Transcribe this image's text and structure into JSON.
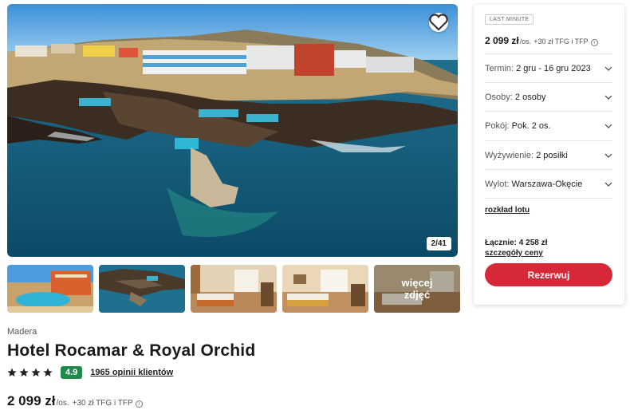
{
  "gallery": {
    "counter": "2/41",
    "more_label": "więcej zdjęć"
  },
  "hotel": {
    "region": "Madera",
    "name": "Hotel Rocamar & Royal Orchid",
    "stars": 4,
    "score": "4.9",
    "reviews": "1965 opinii klientów"
  },
  "price": {
    "amount": "2 099 zł",
    "per": "/os.",
    "extra": "+30 zł TFG i TFP"
  },
  "panel": {
    "badge": "LAST MINUTE",
    "price_amount": "2 099 zł",
    "price_per": "/os.",
    "price_extra": "+30 zł TFG i TFP",
    "options": [
      {
        "label": "Termin:",
        "value": "2 gru - 16 gru 2023"
      },
      {
        "label": "Osoby:",
        "value": "2 osoby"
      },
      {
        "label": "Pokój:",
        "value": "Pok. 2 os."
      },
      {
        "label": "Wyżywienie:",
        "value": "2 posiłki"
      },
      {
        "label": "Wylot:",
        "value": "Warszawa-Okęcie"
      }
    ],
    "flight_link": "rozkład lotu",
    "total": "Łącznie: 4 258 zł",
    "details_link": "szczegóły ceny",
    "book_label": "Rezerwuj"
  },
  "colors": {
    "accent": "#d62839",
    "score": "#1f8a4c"
  }
}
